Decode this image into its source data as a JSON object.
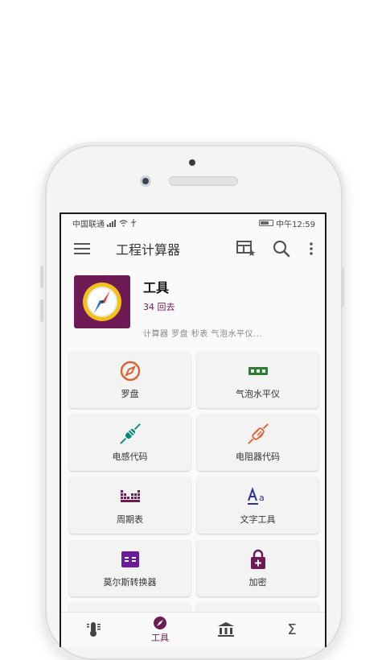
{
  "status": {
    "carrier": "中国联通",
    "time": "中午12:59"
  },
  "appbar": {
    "title": "工程计算器",
    "icons": [
      "menu-icon",
      "table-star-icon",
      "search-icon",
      "more-vert-icon"
    ]
  },
  "category": {
    "title": "工具",
    "subtitle": "34 回去",
    "description": "计算器 罗盘 秒表 气泡水平仪...",
    "icon": "compass-icon",
    "icon_bg": "#6e1a55"
  },
  "tools": [
    {
      "label": "罗盘",
      "icon": "compass-outline-icon",
      "color": "#e0622e"
    },
    {
      "label": "气泡水平仪",
      "icon": "bubble-level-icon",
      "color": "#2e7d32"
    },
    {
      "label": "电感代码",
      "icon": "inductor-icon",
      "color": "#00897b"
    },
    {
      "label": "电阻器代码",
      "icon": "resistor-icon",
      "color": "#e0622e"
    },
    {
      "label": "周期表",
      "icon": "periodic-table-icon",
      "color": "#6e1a55"
    },
    {
      "label": "文字工具",
      "icon": "text-tool-icon",
      "color": "#283593"
    },
    {
      "label": "莫尔斯转换器",
      "icon": "morse-converter-icon",
      "color": "#6a1b9a"
    },
    {
      "label": "加密",
      "icon": "lock-plus-icon",
      "color": "#6e1a55"
    }
  ],
  "bottom_nav": [
    {
      "label": "",
      "icon": "thermometer-icon"
    },
    {
      "label": "工具",
      "icon": "compass-nav-icon",
      "active_color": "#6e1a55"
    },
    {
      "label": "",
      "icon": "bank-icon"
    },
    {
      "label": "",
      "icon": "sigma-icon",
      "glyph": "Σ"
    }
  ]
}
